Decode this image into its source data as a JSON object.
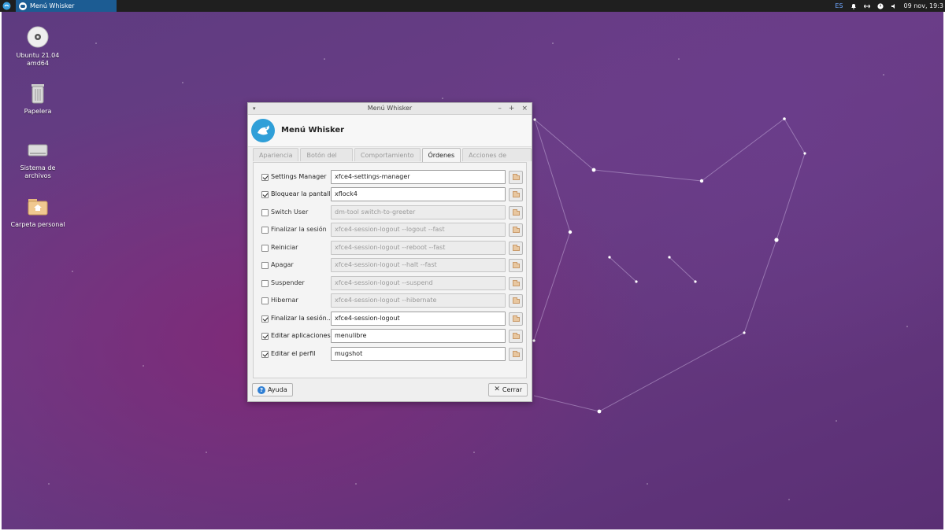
{
  "panel": {
    "task_title": "Menú Whisker",
    "tray_lang": "ES",
    "clock": "09 nov, 19:3"
  },
  "desktop_icons": [
    {
      "label": "Ubuntu 21.04 amd64",
      "icon": "disc-icon"
    },
    {
      "label": "Papelera",
      "icon": "trash-icon"
    },
    {
      "label": "Sistema de archivos",
      "icon": "drive-icon"
    },
    {
      "label": "Carpeta personal",
      "icon": "home-folder-icon"
    }
  ],
  "window": {
    "title": "Menú Whisker",
    "header_title": "Menú Whisker",
    "controls": {
      "minimize": "–",
      "maximize": "+",
      "close": "×"
    },
    "tabs": [
      {
        "label": "Apariencia",
        "active": false
      },
      {
        "label": "Botón del panel",
        "active": false
      },
      {
        "label": "Comportamiento",
        "active": false
      },
      {
        "label": "Órdenes",
        "active": true
      },
      {
        "label": "Acciones de búsqueda",
        "active": false
      }
    ],
    "commands": [
      {
        "label": "Settings Manager",
        "checked": true,
        "value": "xfce4-settings-manager"
      },
      {
        "label": "Bloquear la pantalla",
        "checked": true,
        "value": "xflock4"
      },
      {
        "label": "Switch User",
        "checked": false,
        "value": "dm-tool switch-to-greeter"
      },
      {
        "label": "Finalizar la sesión",
        "checked": false,
        "value": "xfce4-session-logout --logout --fast"
      },
      {
        "label": "Reiniciar",
        "checked": false,
        "value": "xfce4-session-logout --reboot --fast"
      },
      {
        "label": "Apagar",
        "checked": false,
        "value": "xfce4-session-logout --halt --fast"
      },
      {
        "label": "Suspender",
        "checked": false,
        "value": "xfce4-session-logout --suspend"
      },
      {
        "label": "Hibernar",
        "checked": false,
        "value": "xfce4-session-logout --hibernate"
      },
      {
        "label": "Finalizar la sesión...",
        "checked": true,
        "value": "xfce4-session-logout"
      },
      {
        "label": "Editar aplicaciones",
        "checked": true,
        "value": "menulibre"
      },
      {
        "label": "Editar el perfil",
        "checked": true,
        "value": "mugshot"
      }
    ],
    "help_label": "Ayuda",
    "close_label": "Cerrar"
  },
  "colors": {
    "panel_bg": "#1f1f1f",
    "task_active": "#1c5c93",
    "accent_blue": "#2f9fd8",
    "desktop_purple": "#6b3d86"
  }
}
